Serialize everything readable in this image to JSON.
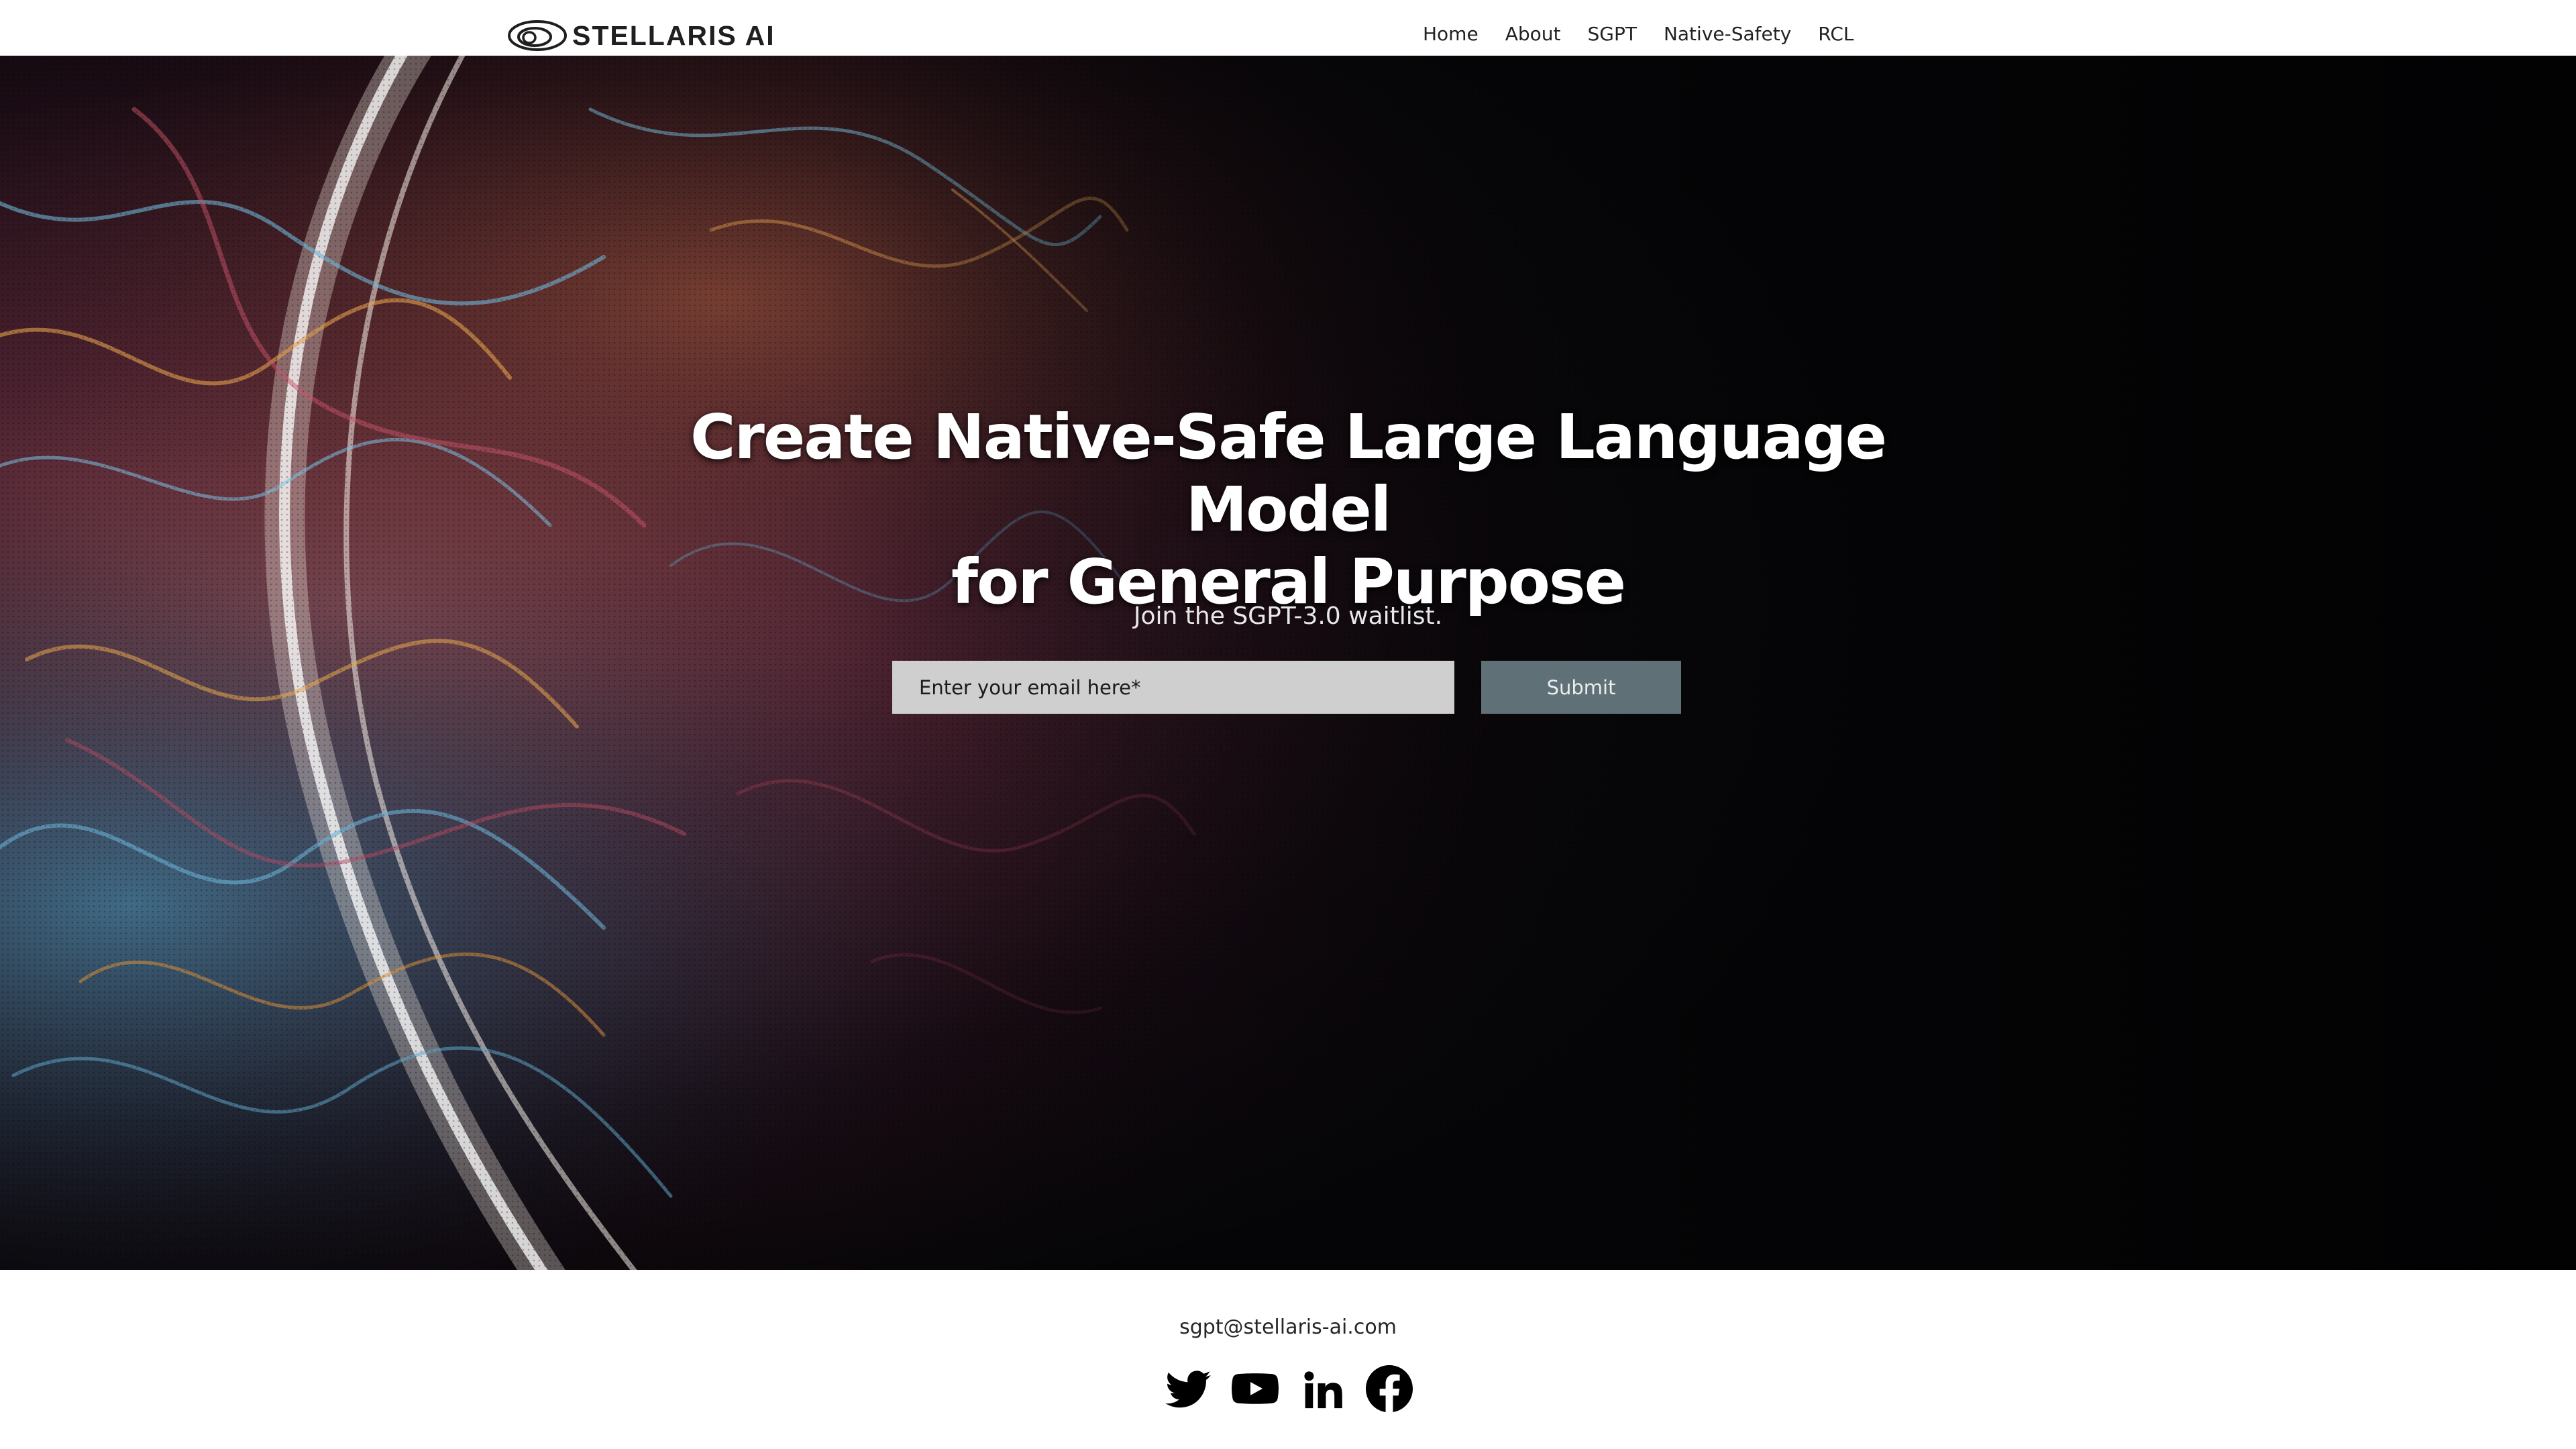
{
  "header": {
    "logo_text": "STELLARIS AI",
    "nav": [
      {
        "label": "Home"
      },
      {
        "label": "About"
      },
      {
        "label": "SGPT"
      },
      {
        "label": "Native-Safety"
      },
      {
        "label": "RCL"
      }
    ]
  },
  "hero": {
    "title_line1": "Create Native-Safe Large Language Model",
    "title_line2": "for General Purpose",
    "subtitle": "Join the SGPT-3.0 waitlist.",
    "email_placeholder": "Enter your email here*",
    "submit_label": "Submit"
  },
  "footer": {
    "email": "sgpt@stellaris-ai.com",
    "social": [
      {
        "name": "twitter-icon"
      },
      {
        "name": "youtube-icon"
      },
      {
        "name": "linkedin-icon"
      },
      {
        "name": "facebook-icon"
      }
    ]
  },
  "colors": {
    "submit_bg": "#5f7177",
    "input_bg": "#cfcfcf",
    "hero_bg": "#050507"
  }
}
